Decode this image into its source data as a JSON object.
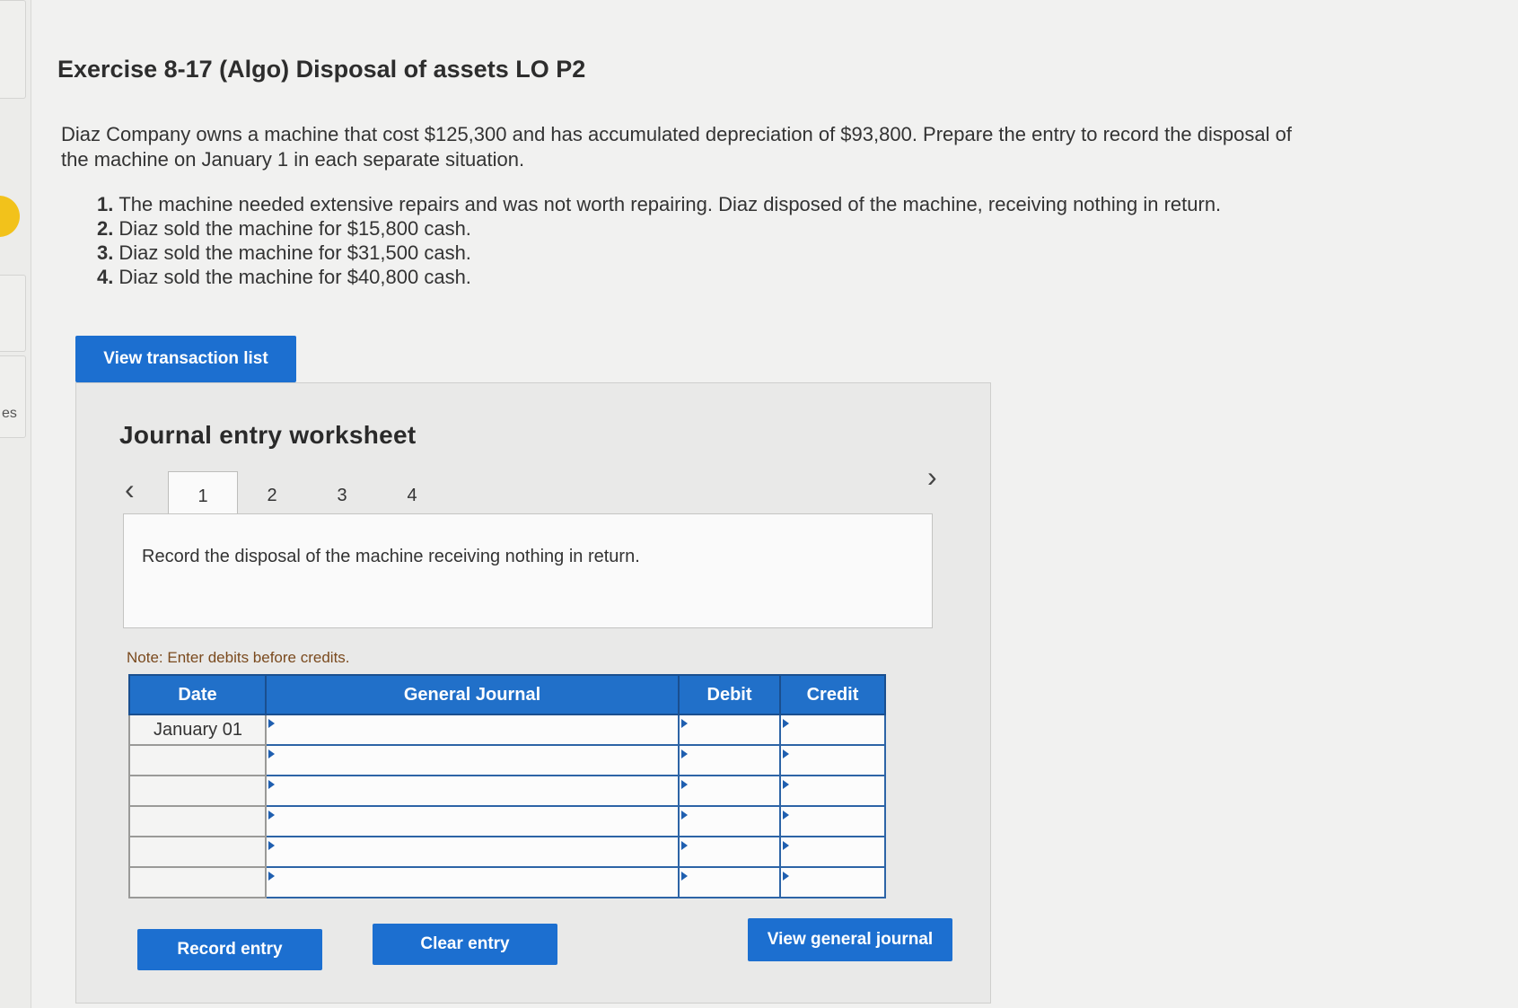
{
  "sidebar": {
    "fragment_text": "es"
  },
  "exercise": {
    "title": "Exercise 8-17 (Algo) Disposal of assets LO P2",
    "intro": "Diaz Company owns a machine that cost $125,300 and has accumulated depreciation of $93,800. Prepare the entry to record the disposal of the machine on January 1 in each separate situation.",
    "scenarios": [
      {
        "num": "1.",
        "text": "The machine needed extensive repairs and was not worth repairing. Diaz disposed of the machine, receiving nothing in return."
      },
      {
        "num": "2.",
        "text": "Diaz sold the machine for $15,800 cash."
      },
      {
        "num": "3.",
        "text": "Diaz sold the machine for $31,500 cash."
      },
      {
        "num": "4.",
        "text": "Diaz sold the machine for $40,800 cash."
      }
    ]
  },
  "buttons": {
    "view_transaction_list": "View transaction list",
    "record_entry": "Record entry",
    "clear_entry": "Clear entry",
    "view_general_journal": "View general journal"
  },
  "worksheet": {
    "title": "Journal entry worksheet",
    "prev_arrow": "‹",
    "next_arrow": "›",
    "tabs": [
      "1",
      "2",
      "3",
      "4"
    ],
    "active_tab": "1",
    "instruction": "Record the disposal of the machine receiving nothing in return.",
    "note": "Note: Enter debits before credits."
  },
  "journal": {
    "headers": {
      "date": "Date",
      "general_journal": "General Journal",
      "debit": "Debit",
      "credit": "Credit"
    },
    "rows": [
      {
        "date": "January 01",
        "account": "",
        "debit": "",
        "credit": ""
      },
      {
        "date": "",
        "account": "",
        "debit": "",
        "credit": ""
      },
      {
        "date": "",
        "account": "",
        "debit": "",
        "credit": ""
      },
      {
        "date": "",
        "account": "",
        "debit": "",
        "credit": ""
      },
      {
        "date": "",
        "account": "",
        "debit": "",
        "credit": ""
      },
      {
        "date": "",
        "account": "",
        "debit": "",
        "credit": ""
      }
    ]
  },
  "colors": {
    "primary_button": "#1c6fd0",
    "table_header": "#2170c9",
    "note_text": "#7a4a1e",
    "indicator_dot": "#f2c21b"
  }
}
